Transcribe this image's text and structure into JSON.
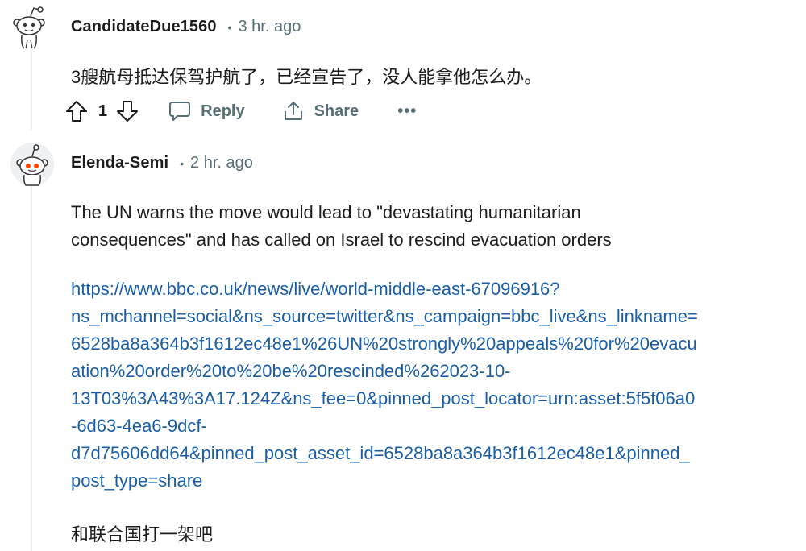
{
  "comments": [
    {
      "username": "CandidateDue1560",
      "separator": "•",
      "timestamp": "3 hr. ago",
      "body": "3艘航母抵达保驾护航了，已经宣告了，没人能拿他怎么办。",
      "actions": {
        "vote_count": "1",
        "reply_label": "Reply",
        "share_label": "Share",
        "more_label": "•••"
      }
    },
    {
      "username": "Elenda-Semi",
      "separator": "•",
      "timestamp": "2 hr. ago",
      "paragraph_1_line_1": "The UN warns the move would lead to \"devastating humanitarian",
      "paragraph_1_line_2": "consequences\" and has called on Israel to rescind evacuation orders",
      "link": "https://www.bbc.co.uk/news/live/world-middle-east-67096916?ns_mchannel=social&ns_source=twitter&ns_campaign=bbc_live&ns_linkname=6528ba8a364b3f1612ec48e1%26UN%20strongly%20appeals%20for%20evacuation%20order%20to%20be%20rescinded%262023-10-13T03%3A43%3A17.124Z&ns_fee=0&pinned_post_locator=urn:asset:5f5f06a0-6d63-4ea6-9dcf-d7d75606dd64&pinned_post_asset_id=6528ba8a364b3f1612ec48e1&pinned_post_type=share",
      "link_lines": [
        "https://www.bbc.co.uk/news/live/world-middle-east-67096916?",
        "ns_mchannel=social&ns_source=twitter&ns_campaign=bbc_live&ns_linkname=",
        "6528ba8a364b3f1612ec48e1%26UN%20strongly%20appeals%20for%20evacu",
        "ation%20order%20to%20be%20rescinded%262023-10-",
        "13T03%3A43%3A17.124Z&ns_fee=0&pinned_post_locator=urn:asset:5f5f06a0",
        "-6d63-4ea6-9dcf-",
        "d7d75606dd64&pinned_post_asset_id=6528ba8a364b3f1612ec48e1&pinned_",
        "post_type=share"
      ],
      "paragraph_2": "和联合国打一架吧"
    }
  ],
  "icons": {
    "avatar": "reddit-snoo-avatar",
    "upvote": "arrow-up-icon",
    "downvote": "arrow-down-icon",
    "reply": "speech-bubble-icon",
    "share": "share-upload-icon"
  },
  "colors": {
    "link": "#1a5ea6",
    "muted": "#576f76",
    "text": "#1c1c1c",
    "thread_line": "#edeff1",
    "avatar_accent": "#ff4500"
  }
}
